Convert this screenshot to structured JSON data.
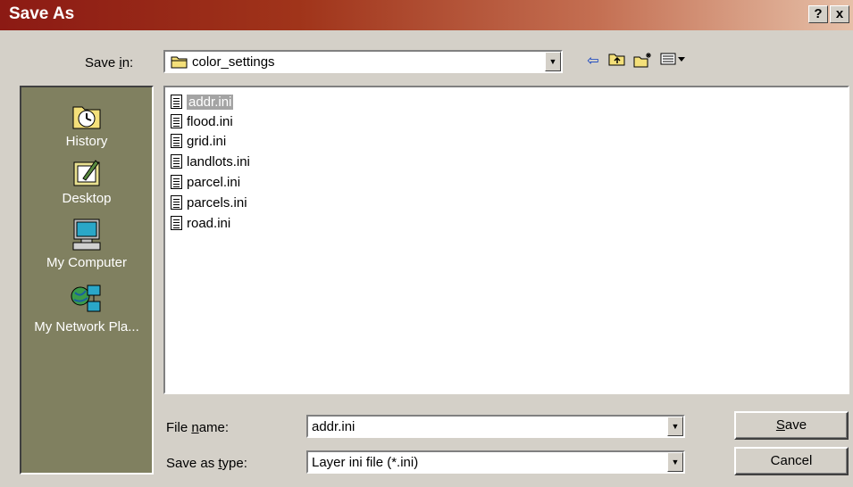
{
  "window": {
    "title": "Save As",
    "help_button": "?",
    "close_button": "x"
  },
  "save_in": {
    "label_prefix": "Save ",
    "label_accel": "i",
    "label_suffix": "n:",
    "value": "color_settings"
  },
  "toolbar": {
    "back_icon": "back-arrow-icon",
    "up_icon": "up-one-level-icon",
    "new_folder_icon": "new-folder-icon",
    "views_icon": "views-menu-icon"
  },
  "places": [
    {
      "label": "History",
      "icon": "history-icon"
    },
    {
      "label": "Desktop",
      "icon": "desktop-icon"
    },
    {
      "label": "My Computer",
      "icon": "my-computer-icon"
    },
    {
      "label": "My Network Pla...",
      "icon": "network-places-icon"
    }
  ],
  "files": [
    {
      "name": "addr.ini",
      "selected": true
    },
    {
      "name": "flood.ini",
      "selected": false
    },
    {
      "name": "grid.ini",
      "selected": false
    },
    {
      "name": "landlots.ini",
      "selected": false
    },
    {
      "name": "parcel.ini",
      "selected": false
    },
    {
      "name": "parcels.ini",
      "selected": false
    },
    {
      "name": "road.ini",
      "selected": false
    }
  ],
  "file_name": {
    "label_prefix": "File ",
    "label_accel": "n",
    "label_suffix": "ame:",
    "value": "addr.ini"
  },
  "save_as_type": {
    "label_prefix": "Save as ",
    "label_accel": "t",
    "label_suffix": "ype:",
    "value": "Layer ini file (*.ini)"
  },
  "buttons": {
    "save_accel": "S",
    "save_rest": "ave",
    "cancel": "Cancel"
  },
  "colors": {
    "title_start": "#8c1a14",
    "title_end": "#e6c0a8",
    "places_bg": "#808060",
    "selection": "#a4a4a4"
  }
}
